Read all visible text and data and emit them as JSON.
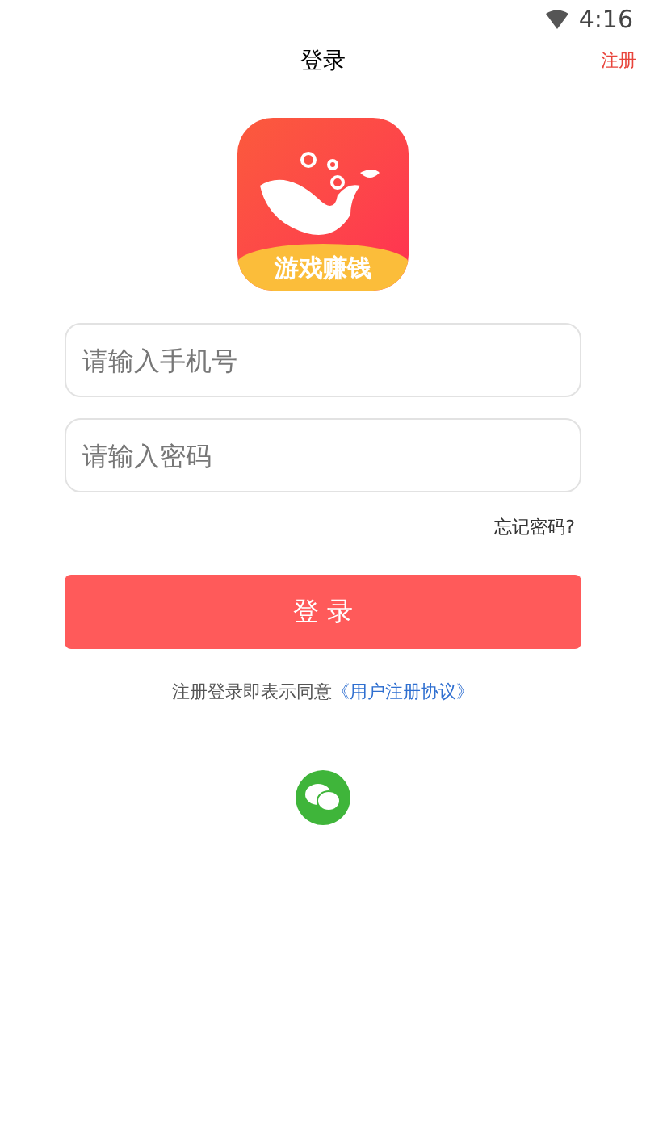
{
  "status_bar": {
    "time": "4:16"
  },
  "header": {
    "title": "登录",
    "action": "注册"
  },
  "logo": {
    "caption": "游戏赚钱"
  },
  "fields": [
    {
      "placeholder": "请输入手机号"
    },
    {
      "placeholder": "请输入密码"
    }
  ],
  "forgot_link": "忘记密码?",
  "login_button": "登 录",
  "agreement": {
    "text": "注册登录即表示同意",
    "link": "《用户注册协议》"
  }
}
